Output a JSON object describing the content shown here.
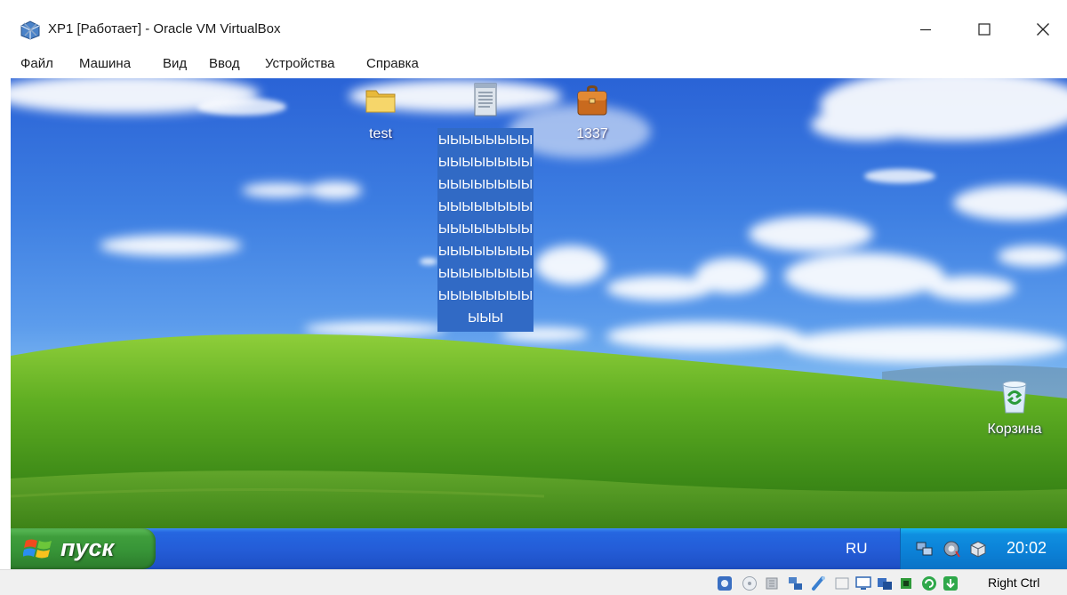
{
  "window": {
    "title": "XP1 [Работает] - Oracle VM VirtualBox",
    "app_icon": "virtualbox-icon",
    "controls": [
      "minimize-icon",
      "maximize-icon",
      "close-icon"
    ]
  },
  "menu": [
    "Файл",
    "Машина",
    "Вид",
    "Ввод",
    "Устройства",
    "Справка"
  ],
  "desktop": {
    "wallpaper": "bliss",
    "icons": [
      {
        "label": "test",
        "icon": "folder-icon"
      },
      {
        "label": "1337",
        "icon": "briefcase-icon"
      },
      {
        "label": "Корзина",
        "icon": "recycle-bin-icon"
      }
    ],
    "selected_file": {
      "icon": "text-document-icon",
      "label_lines": [
        "ЫЫЫЫЫЫЫЫ",
        "ЫЫЫЫЫЫЫЫ",
        "ЫЫЫЫЫЫЫЫ",
        "ЫЫЫЫЫЫЫЫ",
        "ЫЫЫЫЫЫЫЫ",
        "ЫЫЫЫЫЫЫЫ",
        "ЫЫЫЫЫЫЫЫ",
        "ЫЫЫЫЫЫЫЫ",
        "ЫЫЫ"
      ]
    }
  },
  "taskbar": {
    "start_label": "пуск",
    "start_icon": "windows-flag-icon",
    "language": "RU",
    "tray_icons": [
      "network-icon",
      "volume-icon",
      "vbox-additions-icon"
    ],
    "clock": "20:02"
  },
  "statusbar": {
    "icons": [
      "hard-disk-icon",
      "optical-drive-icon",
      "audio-icon",
      "network-adapter-icon",
      "usb-icon",
      "shared-folders-icon",
      "display-icon",
      "video-capture-icon",
      "cpu-icon",
      "mouse-integration-icon",
      "host-key-arrow-icon"
    ],
    "host_key": "Right Ctrl"
  },
  "colors": {
    "selection": "#316ac5",
    "taskbar": "#245dd8",
    "start_button": "#379437",
    "tray": "#0b80d6"
  }
}
